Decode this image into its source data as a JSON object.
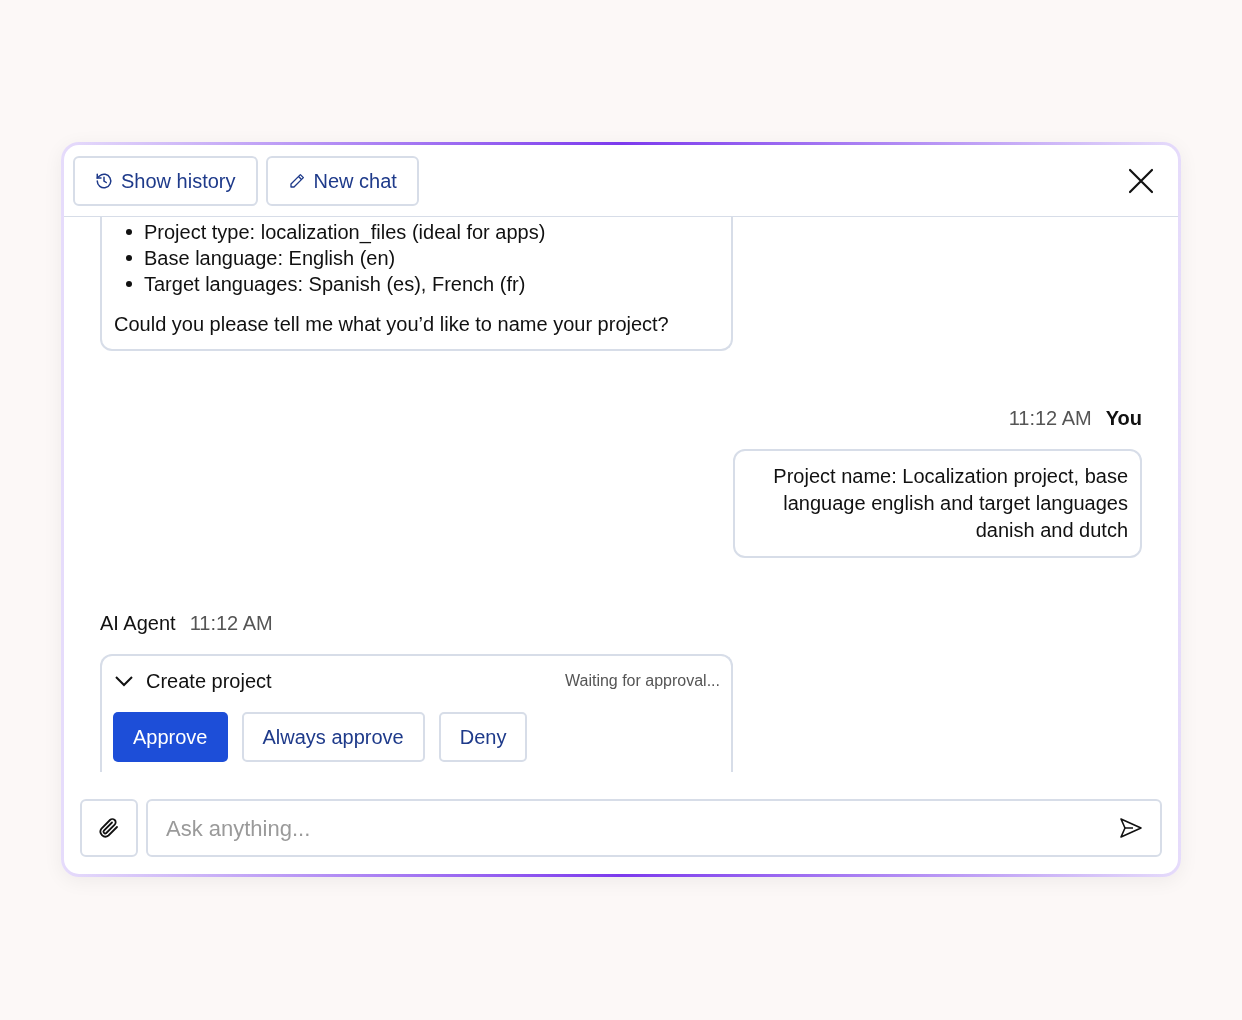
{
  "header": {
    "buttons": [
      {
        "kind": "history",
        "label": "Show history"
      },
      {
        "kind": "new",
        "label": "New chat"
      }
    ]
  },
  "messages": [
    {
      "kind": "agent_text",
      "bullets": [
        "Project type: localization_files (ideal for apps)",
        "Base language: English (en)",
        "Target languages: Spanish (es), French (fr)"
      ],
      "text": "Could you please tell me what you’d like to name your project?"
    },
    {
      "kind": "user",
      "time": "11:12 AM",
      "author": "You",
      "text": "Project name: Localization project, base language english and target languages danish and dutch"
    },
    {
      "kind": "tool_call",
      "author": "AI Agent",
      "time": "11:12 AM",
      "title": "Create project",
      "status": "Waiting for approval...",
      "expanded": true,
      "actions": [
        {
          "label": "Approve",
          "primary": true
        },
        {
          "label": "Always approve",
          "primary": false
        },
        {
          "label": "Deny",
          "primary": false
        }
      ]
    }
  ],
  "composer": {
    "placeholder": "Ask anything..."
  }
}
